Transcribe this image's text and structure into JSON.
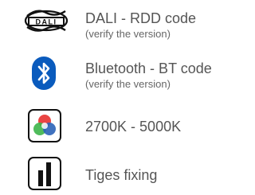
{
  "features": [
    {
      "icon": "dali-logo-icon",
      "label": "DALI - RDD code",
      "note": "(verify the version)",
      "logo_text": "DALI"
    },
    {
      "icon": "bluetooth-icon",
      "label": "Bluetooth - BT code",
      "note": "(verify the version)"
    },
    {
      "icon": "color-temperature-icon",
      "label": "2700K - 5000K"
    },
    {
      "icon": "rod-fixing-icon",
      "label": "Tiges fixing"
    }
  ],
  "colors": {
    "text": "#555555",
    "bluetooth_blue": "#0a5bbd",
    "icon_black": "#111111",
    "rgb_red": "#e8312f",
    "rgb_green": "#3db54a",
    "rgb_blue": "#2b63b8"
  }
}
